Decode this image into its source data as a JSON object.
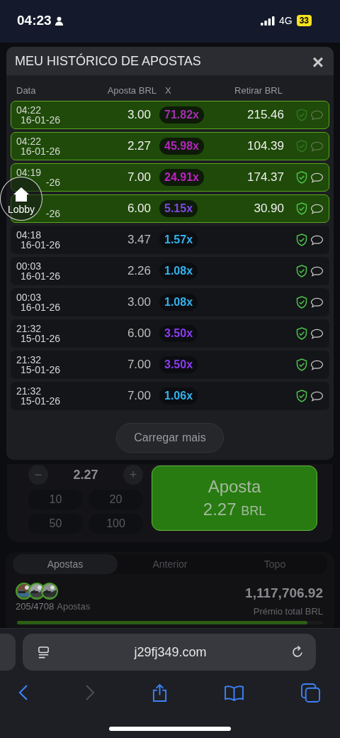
{
  "status_bar": {
    "time": "04:23",
    "network": "4G",
    "battery": "33"
  },
  "modal": {
    "title": "MEU HISTÓRICO DE APOSTAS",
    "close": "×",
    "columns": [
      "Data",
      "Aposta BRL",
      "X",
      "Retirar BRL"
    ],
    "rows": [
      {
        "time": "04:22",
        "date": "16-01-26",
        "bet": "3.00",
        "multiplier": "71.82x",
        "color": "#a52cb2",
        "cashout": "215.46",
        "won": true,
        "dimmed": true
      },
      {
        "time": "04:22",
        "date": "16-01-26",
        "bet": "2.27",
        "multiplier": "45.98x",
        "color": "#b226ba",
        "cashout": "104.39",
        "won": true,
        "dimmed": true
      },
      {
        "time": "04:19",
        "date": "-26",
        "bet": "7.00",
        "multiplier": "24.91x",
        "color": "#c020c6",
        "cashout": "174.37",
        "won": true,
        "dimmed": false
      },
      {
        "date": "-26",
        "bet": "6.00",
        "multiplier": "5.15x",
        "color": "#7f4ae6",
        "cashout": "30.90",
        "won": true,
        "dimmed": false
      },
      {
        "time": "04:18",
        "date": "16-01-26",
        "bet": "3.47",
        "multiplier": "1.57x",
        "color": "#34b2ee",
        "won": false,
        "dimmed": false
      },
      {
        "time": "00:03",
        "date": "16-01-26",
        "bet": "2.26",
        "multiplier": "1.08x",
        "color": "#34b2ee",
        "won": false,
        "dimmed": false
      },
      {
        "time": "00:03",
        "date": "16-01-26",
        "bet": "3.00",
        "multiplier": "1.08x",
        "color": "#34b2ee",
        "won": false,
        "dimmed": false
      },
      {
        "time": "21:32",
        "date": "15-01-26",
        "bet": "6.00",
        "multiplier": "3.50x",
        "color": "#8a3cf2",
        "won": false,
        "dimmed": false
      },
      {
        "time": "21:32",
        "date": "15-01-26",
        "bet": "7.00",
        "multiplier": "3.50x",
        "color": "#8a3cf2",
        "won": false,
        "dimmed": false
      },
      {
        "time": "21:32",
        "date": "15-01-26",
        "bet": "7.00",
        "multiplier": "1.06x",
        "color": "#34b2ee",
        "won": false,
        "dimmed": false
      }
    ],
    "load_more": "Carregar mais"
  },
  "lobby_button": {
    "label": "Lobby"
  },
  "bet_panel": {
    "minus": "−",
    "amount": "2.27",
    "plus": "+",
    "chips": [
      "10",
      "20",
      "50",
      "100"
    ],
    "bet_button": {
      "label": "Aposta",
      "amount": "2.27",
      "currency": "BRL"
    }
  },
  "bets_panel": {
    "tabs": [
      {
        "label": "Apostas",
        "selected": true
      },
      {
        "label": "Anterior",
        "selected": false
      },
      {
        "label": "Topo",
        "selected": false
      }
    ],
    "count": "205/4708",
    "count_label": "Apostas",
    "total": "1,117,706.92",
    "total_label": "Prémio total BRL",
    "progress": {
      "level": 0.95
    }
  },
  "browser": {
    "url": "j29fj349.com"
  }
}
